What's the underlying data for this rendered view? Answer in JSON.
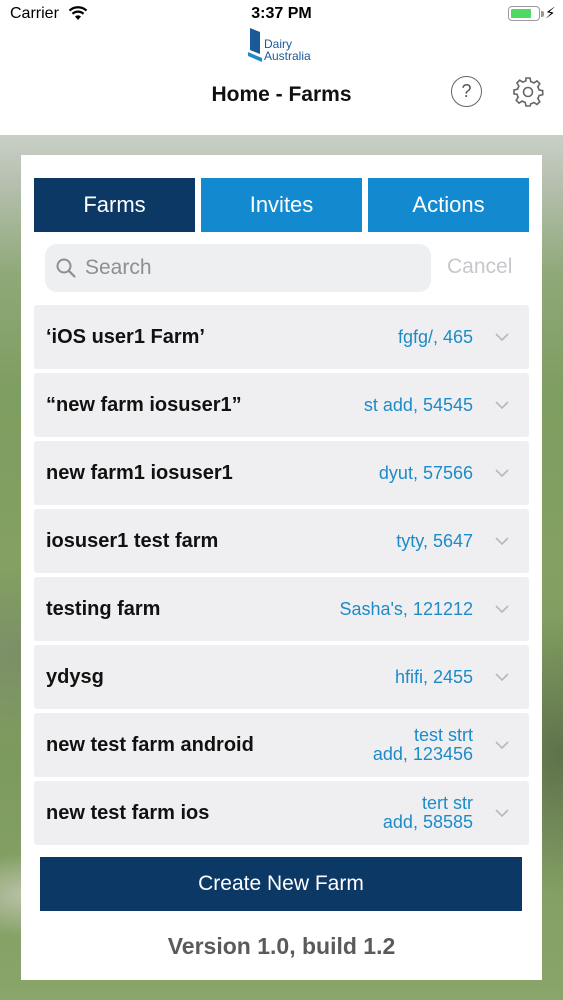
{
  "status_bar": {
    "carrier": "Carrier",
    "time": "3:37 PM",
    "battery_percent": 0.75,
    "battery_color": "#4cd964"
  },
  "header": {
    "logo_line1": "Dairy",
    "logo_line2": "Australia",
    "title": "Home - Farms",
    "help_icon": "question-circle-icon",
    "settings_icon": "gear-icon"
  },
  "tabs": [
    {
      "label": "Farms",
      "selected": true
    },
    {
      "label": "Invites",
      "selected": false
    },
    {
      "label": "Actions",
      "selected": false
    }
  ],
  "search": {
    "placeholder": "Search",
    "value": "",
    "cancel_label": "Cancel"
  },
  "farms": [
    {
      "name": "‘iOS user1 Farm’",
      "address": [
        "fgfg/, 465"
      ]
    },
    {
      "name": "“new farm iosuser1”",
      "address": [
        "st add, 54545"
      ]
    },
    {
      "name": "new farm1 iosuser1",
      "address": [
        "dyut, 57566"
      ]
    },
    {
      "name": "iosuser1 test farm",
      "address": [
        "tyty, 5647"
      ]
    },
    {
      "name": "testing farm",
      "address": [
        "Sasha's, 121212"
      ]
    },
    {
      "name": "ydysg",
      "address": [
        "hfifi, 2455"
      ]
    },
    {
      "name": "new test farm android",
      "address": [
        "test strt",
        "add, 123456"
      ]
    },
    {
      "name": "new test farm ios",
      "address": [
        "tert str",
        "add, 58585"
      ]
    }
  ],
  "create_button_label": "Create New Farm",
  "version_label": "Version 1.0, build 1.2",
  "colors": {
    "primary_dark": "#0c3866",
    "primary_light": "#1389d0",
    "address_blue": "#1e8bc8"
  }
}
